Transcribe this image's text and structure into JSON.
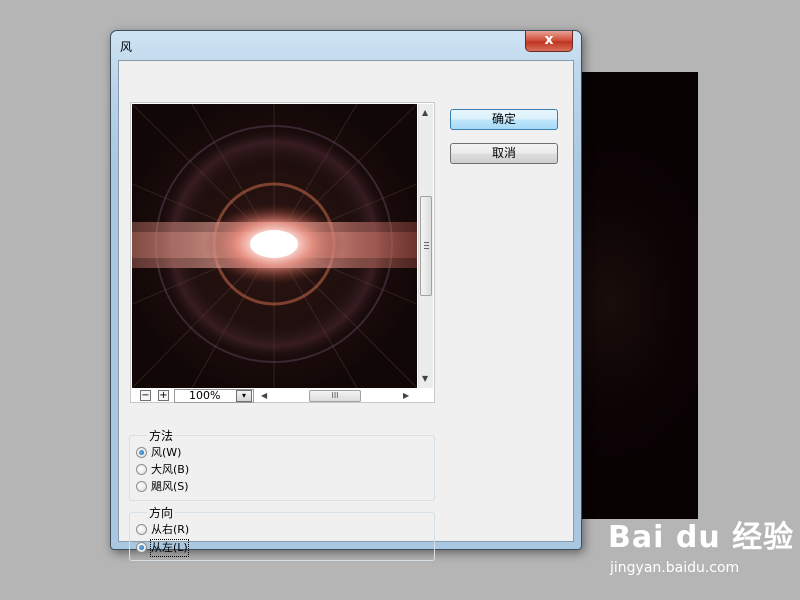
{
  "window": {
    "title": "风",
    "close_label": "x"
  },
  "preview": {
    "zoom": "100%",
    "zoom_out": "−",
    "zoom_in": "+",
    "drop": "▾",
    "hscroll_grip": "III"
  },
  "buttons": {
    "ok": "确定",
    "cancel": "取消"
  },
  "method_group": {
    "title": "方法",
    "options": [
      {
        "label": "风(W)",
        "checked": true
      },
      {
        "label": "大风(B)",
        "checked": false
      },
      {
        "label": "飓风(S)",
        "checked": false
      }
    ]
  },
  "direction_group": {
    "title": "方向",
    "options": [
      {
        "label": "从右(R)",
        "checked": false
      },
      {
        "label": "从左(L)",
        "checked": true
      }
    ]
  },
  "watermark": {
    "logo": "Bai du 经验",
    "url": "jingyan.baidu.com"
  },
  "colors": {
    "dialog_bg": "#f0f0f0",
    "frame": "#a9c7e1",
    "close": "#c03522",
    "accent": "#1a5fa8"
  }
}
